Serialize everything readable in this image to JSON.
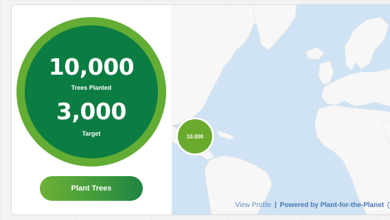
{
  "stats": {
    "planted_count": "10,000",
    "planted_label": "Trees Planted",
    "target_count": "3,000",
    "target_label": "Target"
  },
  "actions": {
    "plant_label": "Plant Trees"
  },
  "map": {
    "cluster_label": "10.000",
    "view_profile_label": "View Profile",
    "separator": "|",
    "powered_label": "Powered by Plant-for-the-Planet",
    "info_glyph": "i"
  },
  "colors": {
    "ring": "#63ad34",
    "disc": "#0b7c42",
    "ocean": "#cfe3f4",
    "land": "#f7f7f7",
    "cluster": "#6aaa2d",
    "link": "#4a79b4"
  }
}
